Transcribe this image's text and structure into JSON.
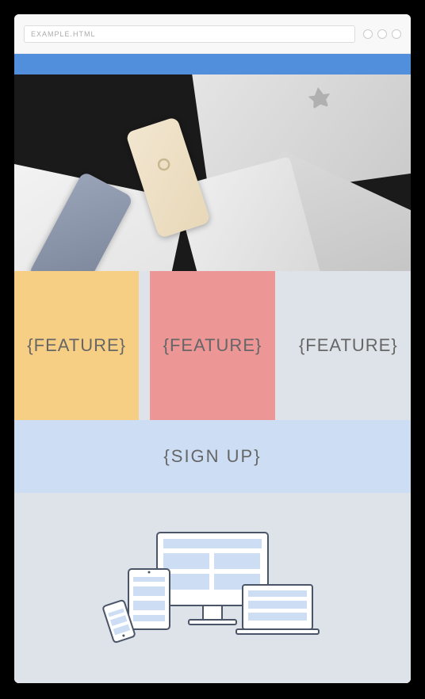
{
  "browser": {
    "url": "EXAMPLE.HTML"
  },
  "features": [
    {
      "label": "{FEATURE}"
    },
    {
      "label": "{FEATURE}"
    },
    {
      "label": "{FEATURE}"
    }
  ],
  "signup": {
    "label": "{SIGN UP}"
  },
  "colors": {
    "header": "#518fdc",
    "feature1": "#f6cf85",
    "feature2": "#c6bdf2",
    "feature3": "#ed9696",
    "signup": "#cddef4",
    "viewport": "#dee3ea"
  }
}
